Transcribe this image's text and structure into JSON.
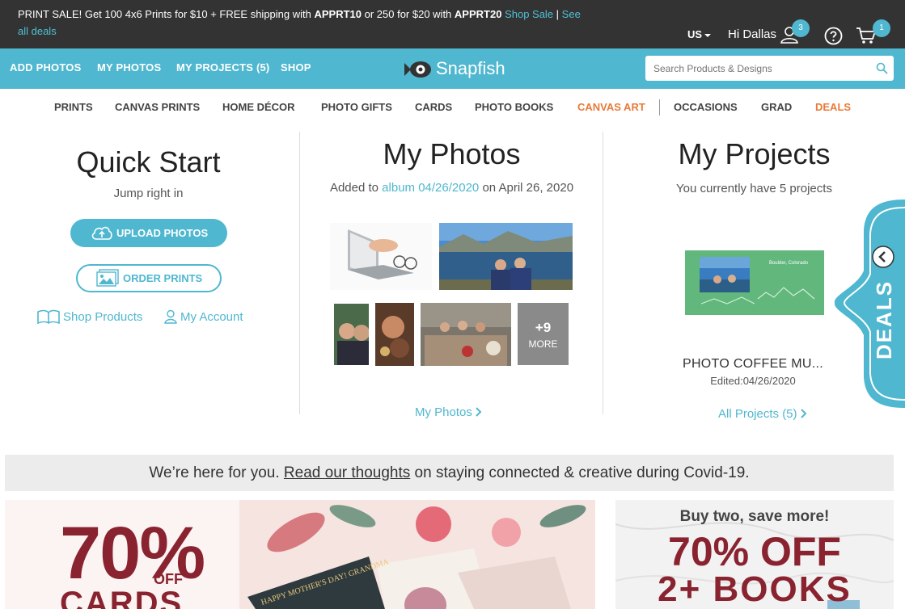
{
  "promo": {
    "prefix": "PRINT SALE! Get 100 4x6 Prints for $10 + FREE shipping with ",
    "code1": "APPRT10",
    "middle": " or 250 for $20 with ",
    "code2": "APPRT20",
    "shop_sale": "Shop Sale",
    "sep": " | ",
    "see_all": "See all deals"
  },
  "account": {
    "country": "US",
    "greeting": "Hi Dallas",
    "user_badge": "3",
    "cart_badge": "1"
  },
  "main_nav": {
    "items": [
      "ADD PHOTOS",
      "MY PHOTOS",
      "MY PROJECTS (5)",
      "SHOP"
    ],
    "logo": "Snapfish",
    "search_placeholder": "Search Products & Designs"
  },
  "categories": {
    "items": [
      "PRINTS",
      "CANVAS PRINTS",
      "HOME DÉCOR",
      "PHOTO GIFTS",
      "CARDS",
      "PHOTO BOOKS",
      "CANVAS ART",
      "OCCASIONS",
      "GRAD",
      "DEALS"
    ]
  },
  "quick_start": {
    "title": "Quick Start",
    "subtitle": "Jump right in",
    "upload": "UPLOAD PHOTOS",
    "order": "ORDER PRINTS",
    "shop_products": "Shop Products",
    "my_account": "My Account"
  },
  "my_photos": {
    "title": "My Photos",
    "added_to": "Added to ",
    "album": "album 04/26/2020",
    "on_date": " on April 26, 2020",
    "more_count": "+9",
    "more_label": "MORE",
    "link": "My Photos"
  },
  "my_projects": {
    "title": "My Projects",
    "subtitle": "You currently have 5 projects",
    "project_name": "PHOTO COFFEE MU...",
    "project_date": "Edited:04/26/2020",
    "link": "All Projects (5)",
    "thumb_caption": "Boulder, Colorado"
  },
  "deals_tab": {
    "label": "DEALS"
  },
  "covid": {
    "before": "We’re here for you. ",
    "link": "Read our thoughts",
    "after": " on staying connected & creative during Covid-19."
  },
  "promo_cards": {
    "big": "70%",
    "off": "OFF",
    "cards": "CARDS",
    "card_text": "HAPPY MOTHER'S DAY! GRANDMA"
  },
  "promo_books": {
    "headline": "Buy two, save more!",
    "big": "70% OFF",
    "books": "2+ BOOKS"
  },
  "colors": {
    "accent": "#4fb7cf",
    "promo_bar": "#333333",
    "orange": "#e87a37",
    "promo_red": "#8a2330"
  }
}
